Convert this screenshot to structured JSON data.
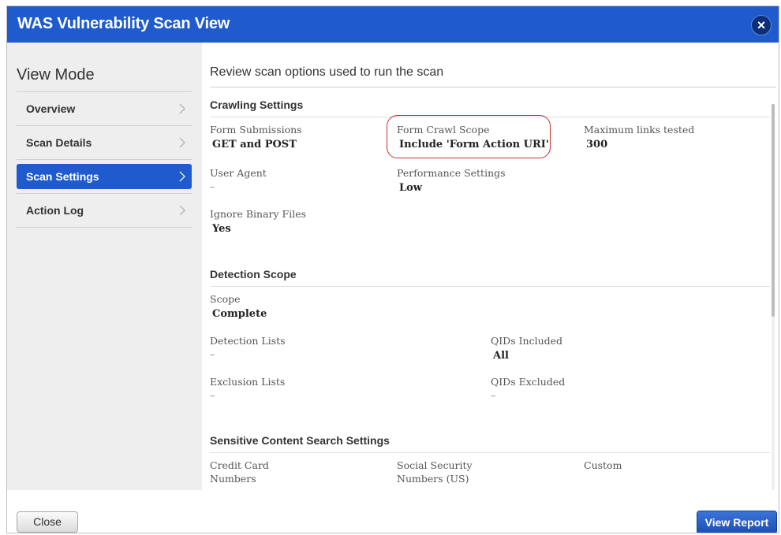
{
  "window": {
    "title": "WAS Vulnerability Scan View",
    "close_glyph": "×"
  },
  "sidebar": {
    "heading": "View Mode",
    "items": [
      {
        "label": "Overview",
        "active": false
      },
      {
        "label": "Scan Details",
        "active": false
      },
      {
        "label": "Scan Settings",
        "active": true
      },
      {
        "label": "Action Log",
        "active": false
      }
    ]
  },
  "main": {
    "heading": "Review scan options used to run the scan",
    "crawling": {
      "title": "Crawling Settings",
      "form_submissions": {
        "label": "Form Submissions",
        "value": "GET and POST"
      },
      "form_crawl_scope": {
        "label": "Form Crawl Scope",
        "value": "Include 'Form Action URI'"
      },
      "max_links": {
        "label": "Maximum links tested",
        "value": "300"
      },
      "user_agent": {
        "label": "User Agent",
        "value": "–"
      },
      "performance": {
        "label": "Performance Settings",
        "value": "Low"
      },
      "ignore_binary": {
        "label": "Ignore Binary Files",
        "value": "Yes"
      }
    },
    "detection": {
      "title": "Detection Scope",
      "scope": {
        "label": "Scope",
        "value": "Complete"
      },
      "detection_lists": {
        "label": "Detection Lists",
        "value": "–"
      },
      "qids_included": {
        "label": "QIDs Included",
        "value": "All"
      },
      "exclusion_lists": {
        "label": "Exclusion Lists",
        "value": "–"
      },
      "qids_excluded": {
        "label": "QIDs Excluded",
        "value": "–"
      }
    },
    "sensitive": {
      "title": "Sensitive Content Search Settings",
      "credit_card": {
        "label_line1": "Credit Card",
        "label_line2": "Numbers"
      },
      "ssn": {
        "label_line1": "Social Security",
        "label_line2": "Numbers (US)"
      },
      "custom": {
        "label": "Custom"
      }
    }
  },
  "footer": {
    "close_label": "Close",
    "view_report_label": "View Report"
  },
  "colors": {
    "accent": "#1f5bcc",
    "highlight_ring": "#c62d2d"
  }
}
